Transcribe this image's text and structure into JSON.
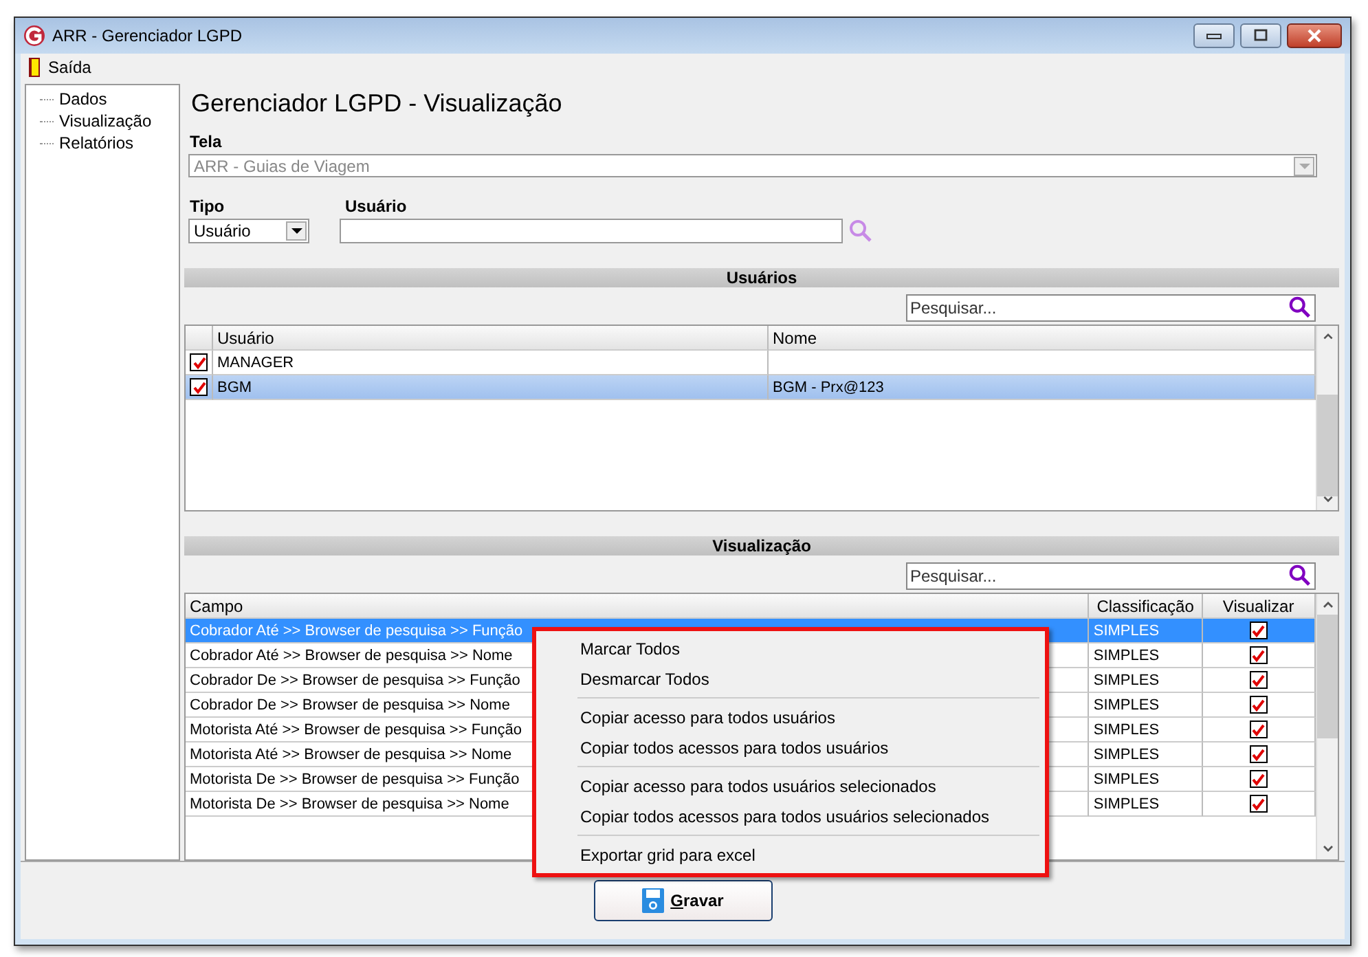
{
  "window": {
    "title": "ARR - Gerenciador LGPD"
  },
  "menu": [
    {
      "label": "Saída"
    }
  ],
  "sidebar": {
    "items": [
      {
        "label": "Dados"
      },
      {
        "label": "Visualização"
      },
      {
        "label": "Relatórios"
      }
    ]
  },
  "heading": "Gerenciador LGPD - Visualização",
  "tela": {
    "label": "Tela",
    "value": "ARR - Guias de Viagem",
    "disabled": true
  },
  "tipo": {
    "label": "Tipo",
    "value": "Usuário"
  },
  "usuario": {
    "label": "Usuário"
  },
  "users": {
    "title": "Usuários",
    "search_placeholder": "Pesquisar...",
    "columns": [
      "Usuário",
      "Nome"
    ],
    "rows": [
      {
        "checked": true,
        "usuario": "MANAGER",
        "selected": false
      },
      {
        "checked": true,
        "usuario": "BGM",
        "nome": "BGM - Prx@123",
        "selected": true
      }
    ]
  },
  "fields": {
    "title": "Visualização",
    "search_placeholder": "Pesquisar...",
    "columns": [
      "Campo",
      "Classificação",
      "Visualizar"
    ],
    "rows": [
      {
        "campo": "Cobrador Até >> Browser de pesquisa >> Função",
        "classificacao": "SIMPLES",
        "checked": true,
        "selected": true
      },
      {
        "campo": "Cobrador Até >> Browser de pesquisa >> Nome",
        "classificacao": "SIMPLES",
        "checked": true,
        "selected": false
      },
      {
        "campo": "Cobrador De >> Browser de pesquisa >> Função",
        "classificacao": "SIMPLES",
        "checked": true,
        "selected": false
      },
      {
        "campo": "Cobrador De >> Browser de pesquisa >> Nome",
        "classificacao": "SIMPLES",
        "checked": true,
        "selected": false
      },
      {
        "campo": "Motorista Até >> Browser de pesquisa >> Função",
        "classificacao": "SIMPLES",
        "checked": true,
        "selected": false
      },
      {
        "campo": "Motorista Até >> Browser de pesquisa >> Nome",
        "classificacao": "SIMPLES",
        "checked": true,
        "selected": false
      },
      {
        "campo": "Motorista De >> Browser de pesquisa >> Função",
        "classificacao": "SIMPLES",
        "checked": true,
        "selected": false
      },
      {
        "campo": "Motorista De >> Browser de pesquisa >> Nome",
        "classificacao": "SIMPLES",
        "checked": true,
        "selected": false
      }
    ]
  },
  "context_menu": {
    "groups": [
      [
        "Marcar Todos",
        "Desmarcar Todos"
      ],
      [
        "Copiar acesso para todos usuários",
        "Copiar todos acessos para todos usuários"
      ],
      [
        "Copiar acesso para todos usuários selecionados",
        "Copiar todos acessos para todos usuários selecionados"
      ],
      [
        "Exportar grid para excel"
      ]
    ]
  },
  "save_button": "Gravar"
}
